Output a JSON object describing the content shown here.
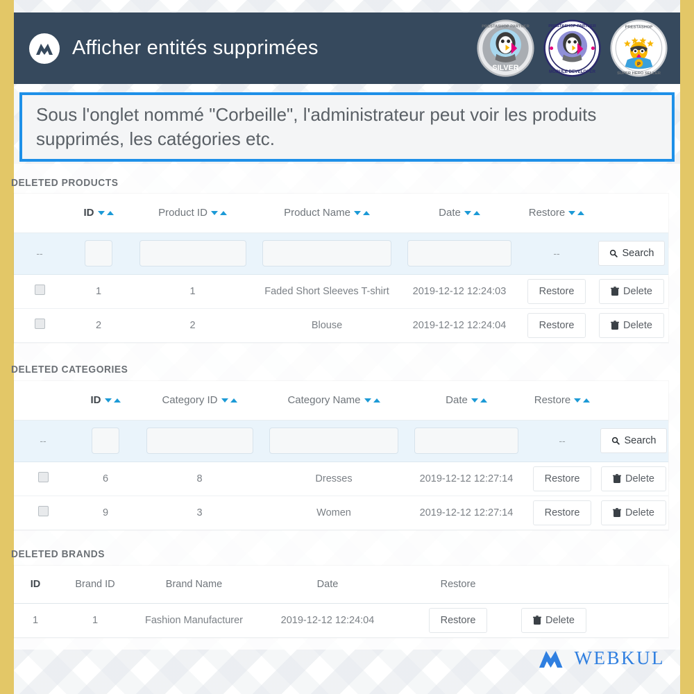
{
  "header": {
    "title": "Afficher entités supprimées",
    "logo_icon": "webkul-logo-icon",
    "badges": [
      {
        "name": "prestashop-partner-silver-badge",
        "top_text": "PRESTASHOP PARTNER",
        "bottom_text": "SILVER"
      },
      {
        "name": "prestashop-partner-module-developer-badge",
        "top_text": "PRESTASHOP PARTNER",
        "bottom_text": "MODULE DEVELOPER"
      },
      {
        "name": "prestashop-super-hero-seller-badge",
        "top_text": "PRESTASHOP",
        "bottom_text": "SUPER HERO SELLER"
      }
    ]
  },
  "callout": {
    "text": "Sous l'onglet nommé \"Corbeille\", l'administrateur peut voir les produits supprimés, les catégories etc.",
    "border_color": "#1e90e8"
  },
  "colors": {
    "page_border": "#e3c767",
    "header_bg": "#36495d",
    "accent": "#1c9ad6",
    "filter_row_bg": "#eaf4fb",
    "brand_blue": "#2f7fe0"
  },
  "sections": {
    "products": {
      "title": "DELETED PRODUCTS",
      "columns": [
        "ID",
        "Product ID",
        "Product Name",
        "Date",
        "Restore"
      ],
      "filter": {
        "checkbox_placeholder": "--",
        "id_value": "",
        "product_id_value": "",
        "product_name_value": "",
        "date_value": "",
        "restore_placeholder": "--",
        "search_label": "Search",
        "search_icon": "search-icon"
      },
      "rows": [
        {
          "id": "1",
          "entity_id": "1",
          "name": "Faded Short Sleeves T-shirt",
          "date": "2019-12-12 12:24:03",
          "restore_label": "Restore",
          "delete_label": "Delete"
        },
        {
          "id": "2",
          "entity_id": "2",
          "name": "Blouse",
          "date": "2019-12-12 12:24:04",
          "restore_label": "Restore",
          "delete_label": "Delete"
        }
      ]
    },
    "categories": {
      "title": "DELETED CATEGORIES",
      "columns": [
        "ID",
        "Category ID",
        "Category Name",
        "Date",
        "Restore"
      ],
      "filter": {
        "checkbox_placeholder": "--",
        "id_value": "",
        "category_id_value": "",
        "category_name_value": "",
        "date_value": "",
        "restore_placeholder": "--",
        "search_label": "Search",
        "search_icon": "search-icon"
      },
      "rows": [
        {
          "id": "6",
          "entity_id": "8",
          "name": "Dresses",
          "date": "2019-12-12 12:27:14",
          "restore_label": "Restore",
          "delete_label": "Delete"
        },
        {
          "id": "9",
          "entity_id": "3",
          "name": "Women",
          "date": "2019-12-12 12:27:14",
          "restore_label": "Restore",
          "delete_label": "Delete"
        }
      ]
    },
    "brands": {
      "title": "DELETED BRANDS",
      "columns": [
        "ID",
        "Brand ID",
        "Brand Name",
        "Date",
        "Restore"
      ],
      "rows": [
        {
          "id": "1",
          "entity_id": "1",
          "name": "Fashion Manufacturer",
          "date": "2019-12-12 12:24:04",
          "restore_label": "Restore",
          "delete_label": "Delete"
        }
      ]
    }
  },
  "footer": {
    "brand": "WEBKUL",
    "logo_icon": "webkul-logo-icon"
  }
}
